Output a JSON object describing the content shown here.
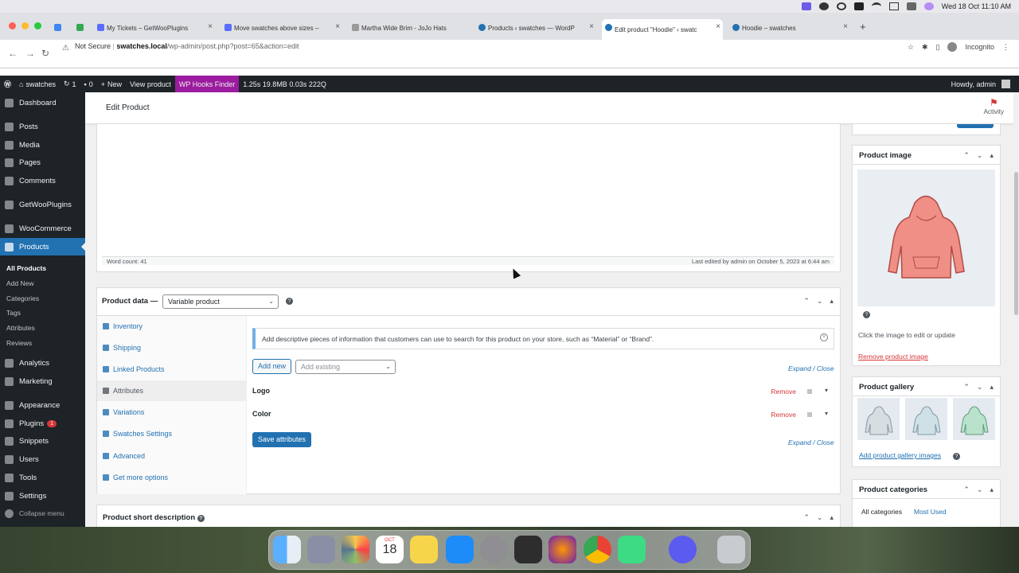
{
  "menubar": {
    "datetime": "Wed 18 Oct  11:10 AM"
  },
  "browser": {
    "tabs": [
      {
        "label": "",
        "color": "#4caf50"
      },
      {
        "label": "My Tickets – GetWooPlugins",
        "color": "#5b6cff"
      },
      {
        "label": "Move swatches above sizes –",
        "color": "#5b6cff"
      },
      {
        "label": "Martha Wide Brim - JoJo Hats",
        "color": "#999999"
      },
      {
        "label": "Products ‹ swatches — WordP",
        "color": "#2271b1"
      },
      {
        "label": "Edit product \"Hoodie\" ‹ swatc",
        "color": "#2271b1"
      },
      {
        "label": "Hoodie – swatches",
        "color": "#2271b1"
      }
    ],
    "security": "Not Secure",
    "url_host": "swatches.local",
    "url_path": "/wp-admin/post.php?post=65&action=edit",
    "profile": "Incognito"
  },
  "adminbar": {
    "site": "swatches",
    "updates": "1",
    "comments": "0",
    "new": "New",
    "view": "View product",
    "hooks": "WP Hooks Finder",
    "stats": "1.25s  19.8MB  0.03s  222Q",
    "howdy": "Howdy, admin"
  },
  "sidebar": {
    "items": [
      {
        "label": "Dashboard",
        "icon": "dashboard-icon"
      },
      {
        "label": "Posts",
        "icon": "pin-icon"
      },
      {
        "label": "Media",
        "icon": "media-icon"
      },
      {
        "label": "Pages",
        "icon": "page-icon"
      },
      {
        "label": "Comments",
        "icon": "comment-icon"
      },
      {
        "label": "GetWooPlugins",
        "icon": "plugin-icon"
      },
      {
        "label": "WooCommerce",
        "icon": "woo-icon"
      },
      {
        "label": "Products",
        "icon": "products-icon"
      },
      {
        "label": "Analytics",
        "icon": "chart-icon"
      },
      {
        "label": "Marketing",
        "icon": "megaphone-icon"
      },
      {
        "label": "Appearance",
        "icon": "brush-icon"
      },
      {
        "label": "Plugins",
        "icon": "plug-icon",
        "badge": "1"
      },
      {
        "label": "Snippets",
        "icon": "code-icon"
      },
      {
        "label": "Users",
        "icon": "users-icon"
      },
      {
        "label": "Tools",
        "icon": "wrench-icon"
      },
      {
        "label": "Settings",
        "icon": "settings-icon"
      },
      {
        "label": "Collapse menu",
        "icon": "collapse-icon"
      }
    ],
    "sub": [
      "All Products",
      "Add New",
      "Categories",
      "Tags",
      "Attributes",
      "Reviews"
    ]
  },
  "header": {
    "title": "Edit Product",
    "activity": "Activity"
  },
  "editor": {
    "word_count": "Word count: 41",
    "last_edited": "Last edited by admin on October 5, 2023 at 6:44 am"
  },
  "product_data": {
    "label": "Product data —",
    "type": "Variable product",
    "tabs": [
      "Inventory",
      "Shipping",
      "Linked Products",
      "Attributes",
      "Variations",
      "Swatches Settings",
      "Advanced",
      "Get more options"
    ],
    "notice": "Add descriptive pieces of information that customers can use to search for this product on your store, such as “Material” or “Brand”.",
    "add_new": "Add new",
    "add_existing": "Add existing",
    "expand_close": "Expand / Close",
    "attributes": [
      {
        "name": "Logo",
        "remove": "Remove"
      },
      {
        "name": "Color",
        "remove": "Remove"
      }
    ],
    "save": "Save attributes"
  },
  "short_desc": {
    "label": "Product short description"
  },
  "product_image": {
    "label": "Product image",
    "hint": "Click the image to edit or update",
    "remove": "Remove product image"
  },
  "gallery": {
    "label": "Product gallery",
    "add": "Add product gallery images"
  },
  "categories": {
    "label": "Product categories",
    "all": "All categories",
    "most": "Most Used"
  },
  "dock": {
    "date_month": "OCT",
    "date_day": "18"
  }
}
